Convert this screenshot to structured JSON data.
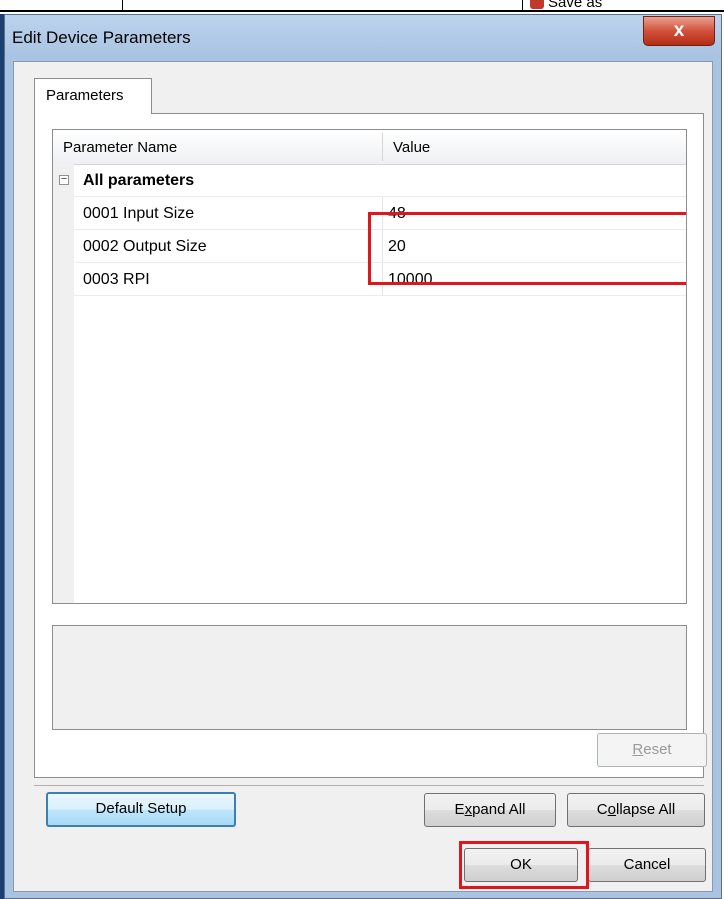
{
  "background_app": {
    "partial_text": "Save as"
  },
  "window": {
    "title": "Edit Device Parameters",
    "close_glyph": "x"
  },
  "tabs": [
    {
      "label": "Parameters",
      "active": true
    }
  ],
  "grid": {
    "columns": [
      "Parameter Name",
      "Value"
    ],
    "group": {
      "label": "All parameters",
      "expander": "−"
    },
    "rows": [
      {
        "name": "0001 Input Size",
        "value": "48"
      },
      {
        "name": "0002 Output Size",
        "value": "20"
      },
      {
        "name": "0003 RPI",
        "value": "10000"
      }
    ]
  },
  "buttons": {
    "reset": {
      "pre": "",
      "accel": "R",
      "post": "eset",
      "enabled": false
    },
    "default_setup": {
      "label": "Default Setup"
    },
    "expand_all": {
      "pre": "E",
      "accel": "x",
      "post": "pand All"
    },
    "collapse_all": {
      "pre": "C",
      "accel": "o",
      "post": "llapse All"
    },
    "ok": {
      "label": "OK"
    },
    "cancel": {
      "label": "Cancel"
    }
  },
  "colors": {
    "highlight": "#e0161e",
    "titlebar": "#a9c4e3",
    "close_button": "#d2513a"
  }
}
